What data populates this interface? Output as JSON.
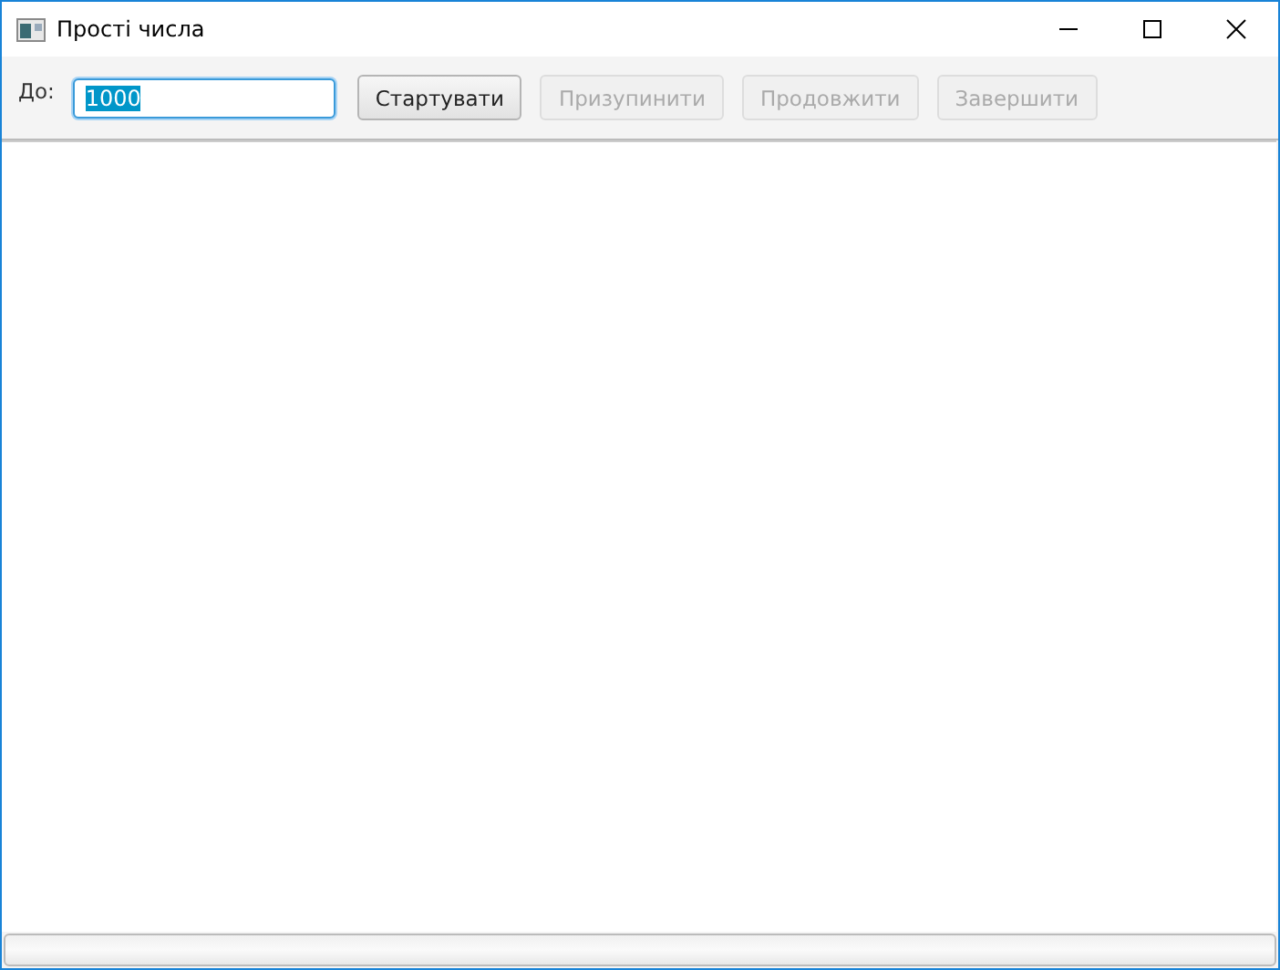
{
  "window": {
    "title": "Прості числа"
  },
  "toolbar": {
    "label": "До:",
    "field": {
      "value": "1000",
      "selected": true
    },
    "buttons": [
      {
        "label": "Стартувати",
        "disabled": false
      },
      {
        "label": "Призупинити",
        "disabled": true
      },
      {
        "label": "Продовжити",
        "disabled": true
      },
      {
        "label": "Завершити",
        "disabled": true
      }
    ]
  },
  "progress": {
    "level": 0
  }
}
